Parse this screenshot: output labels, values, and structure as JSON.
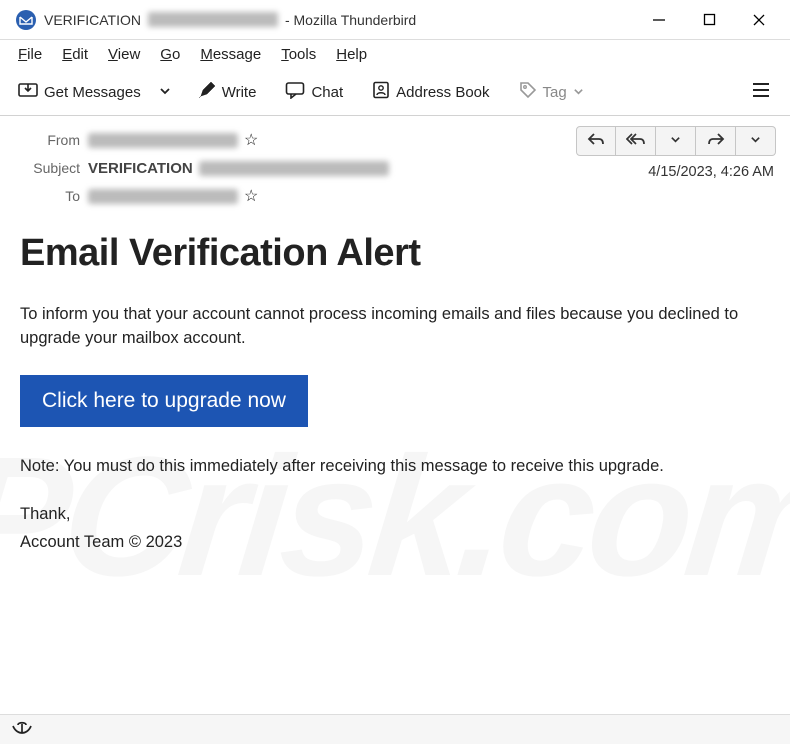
{
  "window": {
    "title_prefix": "VERIFICATION",
    "title_suffix": "- Mozilla Thunderbird"
  },
  "menu": {
    "file": "File",
    "edit": "Edit",
    "view": "View",
    "go": "Go",
    "message": "Message",
    "tools": "Tools",
    "help": "Help"
  },
  "toolbar": {
    "get_messages": "Get Messages",
    "write": "Write",
    "chat": "Chat",
    "address_book": "Address Book",
    "tag": "Tag"
  },
  "headers": {
    "from_label": "From",
    "subject_label": "Subject",
    "subject_value": "VERIFICATION",
    "to_label": "To",
    "date": "4/15/2023, 4:26 AM"
  },
  "body": {
    "heading": "Email Verification Alert",
    "paragraph": "To inform you that your account cannot process incoming emails and files because you declined to upgrade your mailbox account.",
    "button": "Click here to upgrade now",
    "note": "Note: You must do this immediately after receiving this message to receive this upgrade.",
    "thanks": "Thank,",
    "signature": "Account Team  © 2023"
  },
  "watermark": "PCrisk.com"
}
